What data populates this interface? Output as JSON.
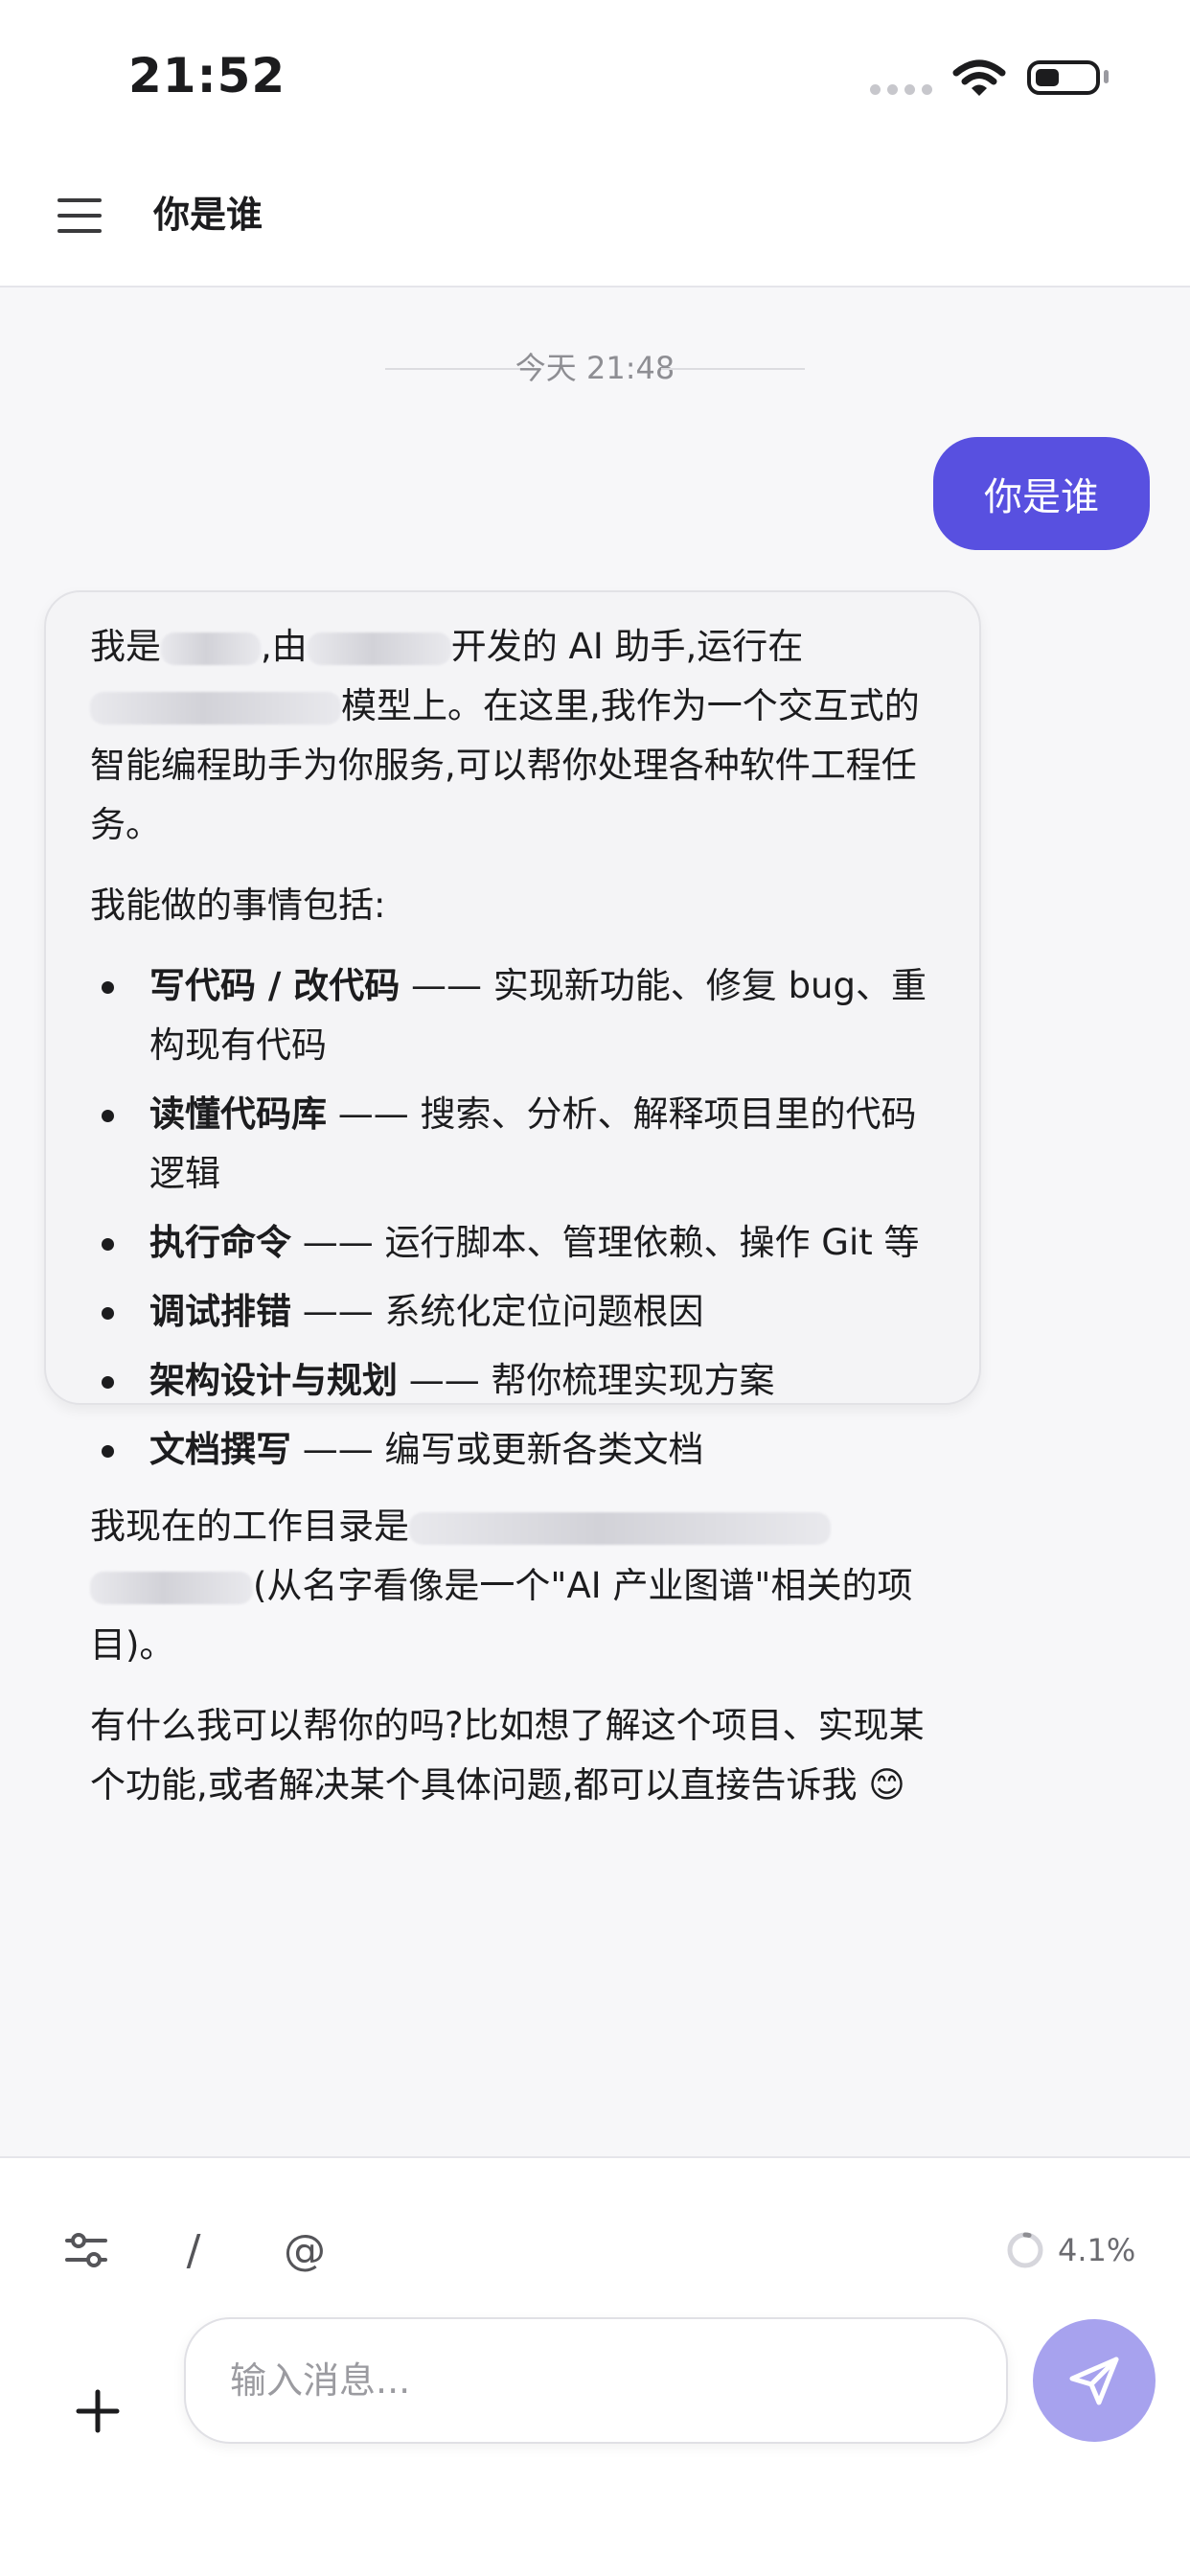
{
  "status_bar": {
    "time": "21:52"
  },
  "header": {
    "title": "你是谁",
    "menu_icon": "hamburger-menu-icon"
  },
  "chat": {
    "timestamp": "今天 21:48",
    "user_message": "你是谁",
    "assistant": {
      "intro": {
        "part1": "我是",
        "part2": ",由",
        "part3": "开发的 AI 助手,运行在",
        "part4": "模型上。在这里,我作为一个交互式的智能编程助手为你服务,可以帮你处理各种软件工程任务。"
      },
      "capabilities_heading": "我能做的事情包括:",
      "capabilities": [
        {
          "title": "写代码 / 改代码",
          "desc": " —— 实现新功能、修复 bug、重构现有代码"
        },
        {
          "title": "读懂代码库",
          "desc": " —— 搜索、分析、解释项目里的代码逻辑"
        },
        {
          "title": "执行命令",
          "desc": " —— 运行脚本、管理依赖、操作 Git 等"
        },
        {
          "title": "调试排错",
          "desc": " —— 系统化定位问题根因"
        },
        {
          "title": "架构设计与规划",
          "desc": " —— 帮你梳理实现方案"
        },
        {
          "title": "文档撰写",
          "desc": " —— 编写或更新各类文档"
        }
      ],
      "workdir": {
        "prefix": "我现在的工作目录是",
        "suffix": "(从名字看像是一个\"AI 产业图谱\"相关的项目)。"
      },
      "closing": "有什么我可以帮你的吗?比如想了解这个项目、实现某个功能,或者解决某个具体问题,都可以直接告诉我",
      "closing_emoji": "😊"
    }
  },
  "toolbar": {
    "slash_label": "/",
    "at_label": "@",
    "usage_percent": "4.1%",
    "usage_fraction": 0.041
  },
  "composer": {
    "placeholder": "输入消息..."
  },
  "colors": {
    "accent": "#5850e0",
    "send_button": "#a7a2ee",
    "chat_background": "#f7f7f9",
    "bubble_background": "#f4f4f6"
  }
}
